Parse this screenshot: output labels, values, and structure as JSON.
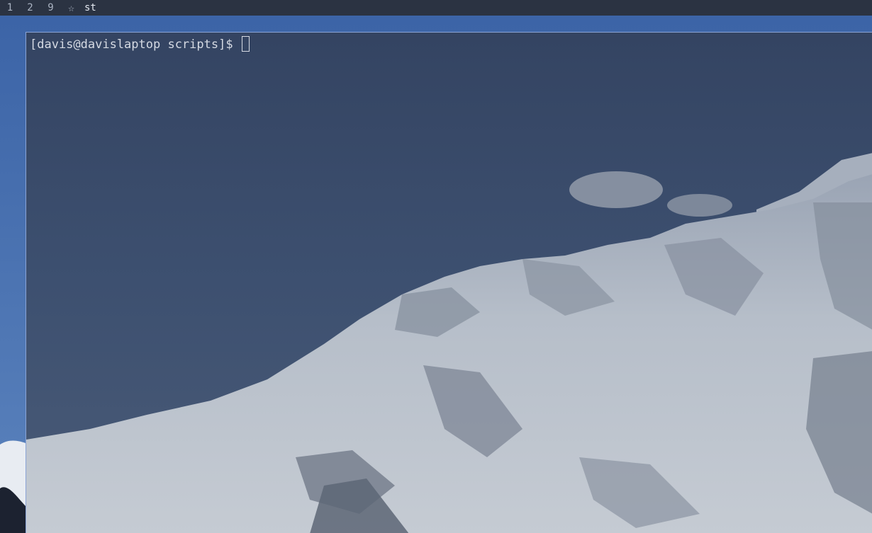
{
  "bar": {
    "tags": [
      "1",
      "2",
      "9"
    ],
    "layout_symbol": "☆",
    "window_title": "st"
  },
  "terminal": {
    "prompt": "[davis@davislaptop scripts]$ "
  },
  "colors": {
    "bar_bg": "#2b3342",
    "terminal_tint": "#2f3b52",
    "terminal_text": "#d5dae3",
    "window_border": "#8aa4d6"
  }
}
